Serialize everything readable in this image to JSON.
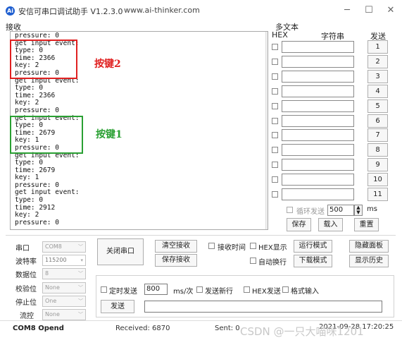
{
  "window": {
    "app_icon_glyph": "Ai",
    "title": "安信可串口调试助手 V1.2.3.0",
    "url": "www.ai-thinker.com",
    "min_icon": "minimize-icon",
    "max_icon": "maximize-icon",
    "close_icon": "close-icon"
  },
  "receive": {
    "label": "接收",
    "lines": [
      "pressure: 0",
      "get input event:",
      "type: 0",
      "time: 2366",
      "key: 2",
      "pressure: 0",
      "get input event:",
      "type: 0",
      "time: 2366",
      "key: 2",
      "pressure: 0",
      "get input event:",
      "type: 0",
      "time: 2679",
      "key: 1",
      "pressure: 0",
      "get input event:",
      "type: 0",
      "time: 2679",
      "key: 1",
      "pressure: 0",
      "get input event:",
      "type: 0",
      "time: 2912",
      "key: 2",
      "pressure: 0"
    ],
    "annotation_red": "按键2",
    "annotation_green": "按键1",
    "annotation_red_color": "#e02020",
    "annotation_green_color": "#2aa033"
  },
  "multi": {
    "title": "多文本",
    "col_hex": "HEX",
    "col_string": "字符串",
    "col_send": "发送",
    "rows": [
      "1",
      "2",
      "3",
      "4",
      "5",
      "6",
      "7",
      "8",
      "9",
      "10",
      "11"
    ],
    "loop_label": "循环发送",
    "loop_value": "500",
    "loop_unit": "ms",
    "save_btn": "保存",
    "load_btn": "载入",
    "reset_btn": "重置"
  },
  "settings": {
    "port_label": "串口",
    "port_value": "COM8",
    "baud_label": "波特率",
    "baud_value": "115200",
    "databits_label": "数据位",
    "databits_value": "8",
    "parity_label": "校验位",
    "parity_value": "None",
    "stopbits_label": "停止位",
    "stopbits_value": "One",
    "flow_label": "流控",
    "flow_value": "None"
  },
  "controls": {
    "close_port": "关闭串口",
    "clear_recv": "清空接收",
    "save_recv": "保存接收",
    "recv_time": "接收时间",
    "hex_display": "HEX显示",
    "run_mode": "运行模式",
    "hide_panel": "隐藏面板",
    "auto_newline": "自动换行",
    "download_mode": "下载模式",
    "show_history": "显示历史",
    "timed_send": "定时发送",
    "interval_value": "800",
    "interval_unit": "ms/次",
    "send_newline": "发送新行",
    "hex_send": "HEX发送",
    "format_input": "格式输入",
    "send_btn": "发送"
  },
  "status": {
    "port_state": "COM8 Opend",
    "received": "Received: 6870",
    "sent": "Sent: 0",
    "timestamp": "2021-09-28 17:20:25"
  },
  "watermark": "CSDN @一只大喵咪1201"
}
